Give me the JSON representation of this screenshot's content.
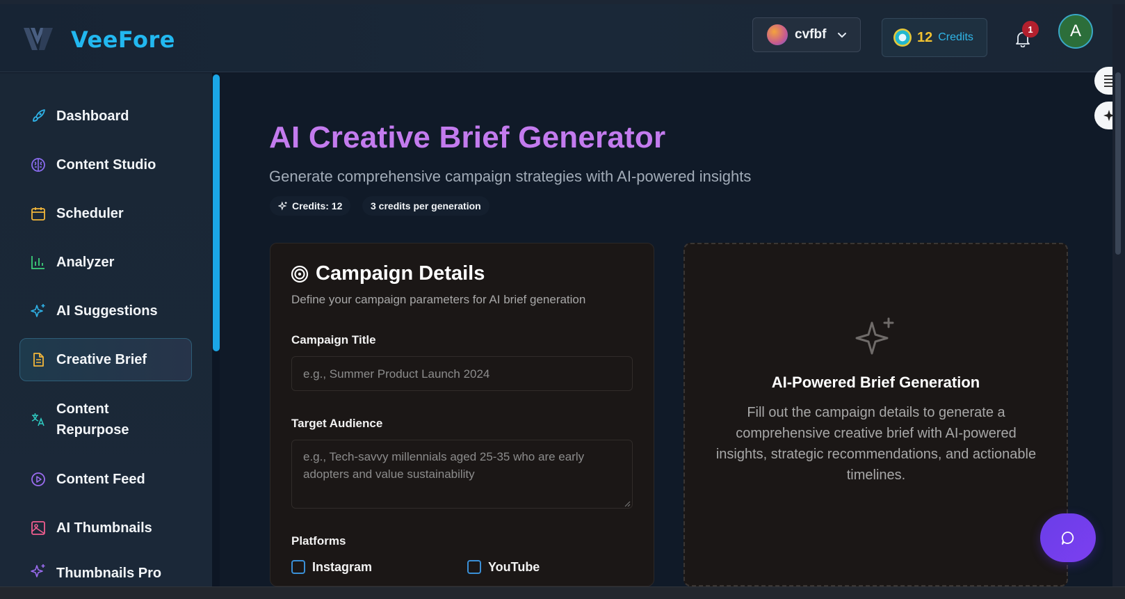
{
  "app": {
    "name": "VeeFore"
  },
  "header": {
    "workspace_name": "cvfbf",
    "credits_value": "12",
    "credits_label": "Credits",
    "notification_count": "1",
    "user_initial": "A"
  },
  "sidebar": {
    "items": [
      {
        "label": "Dashboard",
        "icon": "rocket-icon"
      },
      {
        "label": "Content Studio",
        "icon": "brain-icon"
      },
      {
        "label": "Scheduler",
        "icon": "calendar-icon"
      },
      {
        "label": "Analyzer",
        "icon": "bar-chart-icon"
      },
      {
        "label": "AI Suggestions",
        "icon": "sparkles-icon"
      },
      {
        "label": "Creative Brief",
        "icon": "document-icon",
        "active": true
      },
      {
        "label": "Content Repurpose",
        "icon": "translate-icon"
      },
      {
        "label": "Content Feed",
        "icon": "play-circle-icon"
      },
      {
        "label": "AI Thumbnails",
        "icon": "image-icon"
      },
      {
        "label": "Thumbnails Pro",
        "icon": "sparkles-icon"
      }
    ]
  },
  "page": {
    "title": "AI Creative Brief Generator",
    "subtitle": "Generate comprehensive campaign strategies with AI-powered insights",
    "credits_pill": "Credits: 12",
    "cost_pill": "3 credits per generation"
  },
  "form": {
    "title": "Campaign Details",
    "description": "Define your campaign parameters for AI brief generation",
    "campaign_title_label": "Campaign Title",
    "campaign_title_placeholder": "e.g., Summer Product Launch 2024",
    "audience_label": "Target Audience",
    "audience_placeholder": "e.g., Tech-savvy millennials aged 25-35 who are early adopters and value sustainability",
    "platforms_label": "Platforms",
    "platforms": [
      "Instagram",
      "YouTube"
    ]
  },
  "preview": {
    "title": "AI-Powered Brief Generation",
    "description": "Fill out the campaign details to generate a comprehensive creative brief with AI-powered insights, strategic recommendations, and actionable timelines."
  },
  "colors": {
    "accent": "#22b8f0",
    "title": "#c37bee",
    "credits": "#f2c230"
  }
}
